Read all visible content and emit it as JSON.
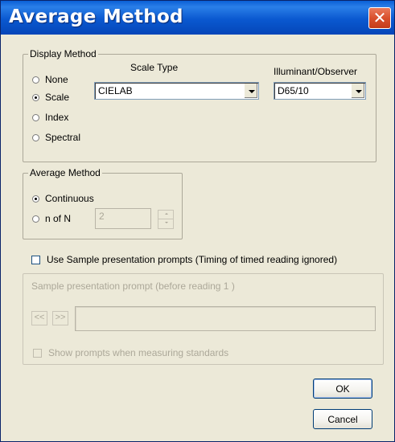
{
  "window": {
    "title": "Average Method",
    "close_glyph": "✕"
  },
  "display_method": {
    "legend": "Display Method",
    "options": [
      "None",
      "Scale",
      "Index",
      "Spectral"
    ],
    "selected": "Scale",
    "scale_type_label": "Scale Type",
    "scale_type_value": "CIELAB",
    "illuminant_label": "Illuminant/Observer",
    "illuminant_value": "D65/10"
  },
  "average_method": {
    "legend": "Average Method",
    "options": [
      "Continuous",
      "n of N"
    ],
    "selected": "Continuous",
    "n_value": "2"
  },
  "sample_prompts": {
    "checkbox_label": "Use Sample presentation prompts (Timing of timed reading ignored)",
    "group_legend": "Sample presentation prompt (before reading 1 )",
    "prev_glyph": "<<",
    "next_glyph": ">>",
    "prompt_text": "",
    "show_standards_label": "Show prompts when measuring standards"
  },
  "buttons": {
    "ok": "OK",
    "cancel": "Cancel"
  },
  "icons": {
    "close": "close-icon",
    "dropdown": "chevron-down-icon"
  }
}
